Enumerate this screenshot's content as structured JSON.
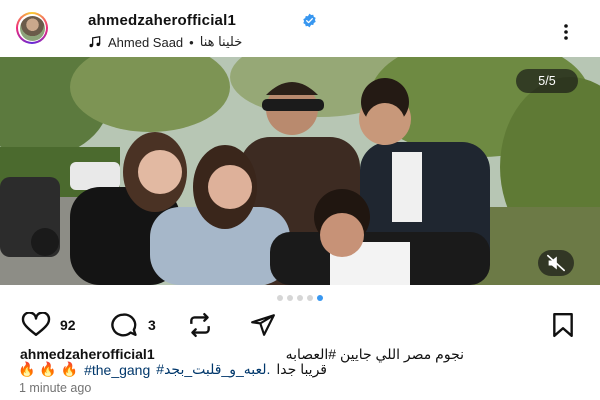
{
  "post": {
    "username": "ahmedzaherofficial1",
    "audio": {
      "artist": "Ahmed Saad",
      "separator": "•",
      "song": "خلينا هنا"
    },
    "slide_counter": "5/5",
    "carousel": {
      "total": 5,
      "active_index": 4
    },
    "likes": "92",
    "comments": "3",
    "caption": {
      "username": "ahmedzaherofficial1",
      "line1": "نجوم مصر اللي جايين #العصابه",
      "line2_emojis": "🔥 🔥 🔥",
      "line2_tag1": "#the_gang",
      "line2_tag2": "#لعبه_و_قلبت_بجد.",
      "line2_end": "قريبا جدا"
    },
    "time": "1 minute ago"
  },
  "colors": {
    "verified": "#3897f0",
    "hashtag": "#00376b",
    "active_dot": "#3897f0"
  },
  "icons": [
    "verified-badge-icon",
    "music-note-icon",
    "more-options-icon",
    "mute-icon",
    "heart-icon",
    "comment-icon",
    "repost-icon",
    "share-icon",
    "bookmark-icon"
  ]
}
